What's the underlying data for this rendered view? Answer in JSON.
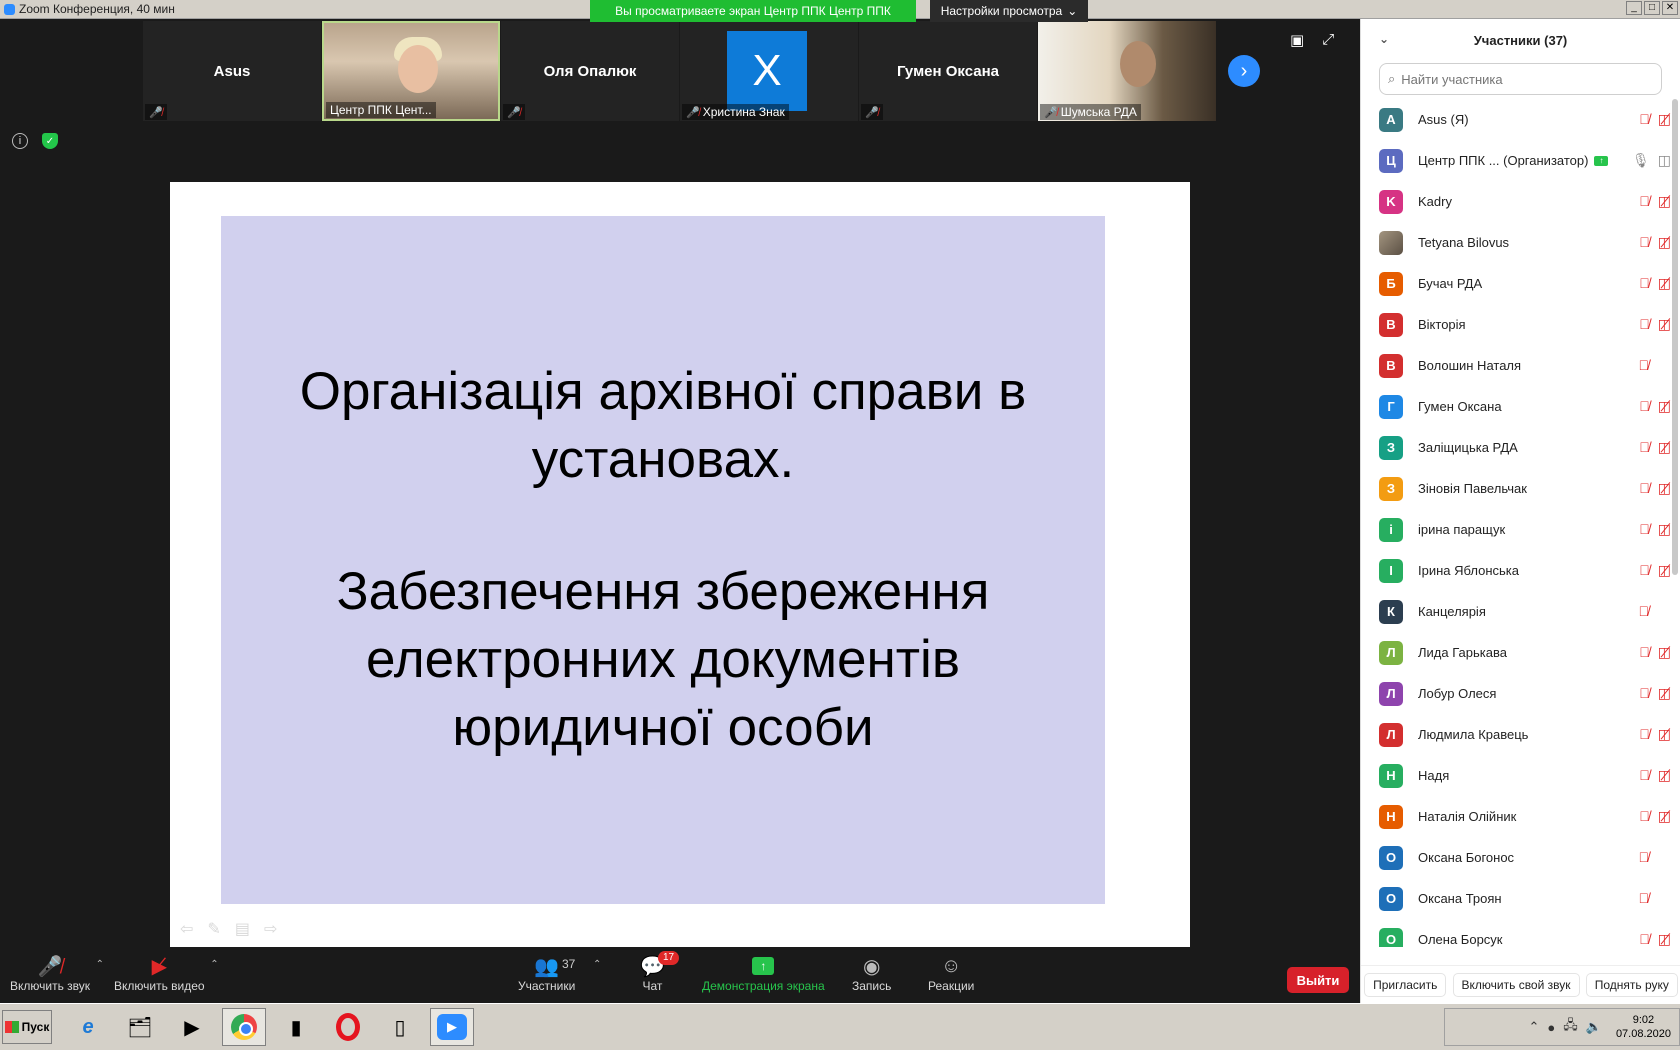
{
  "window": {
    "title": "Zoom Конференция, 40 мин",
    "share_banner": "Вы просматриваете экран Центр ППК Центр ППК",
    "view_settings": "Настройки просмотра"
  },
  "video_strip": [
    {
      "name": "Asus",
      "label": "",
      "kind": "name"
    },
    {
      "name": "",
      "label": "Центр ППК Цент...",
      "kind": "photo-a"
    },
    {
      "name": "Оля Опалюк",
      "label": "",
      "kind": "name"
    },
    {
      "name": "",
      "label": "Христина Знак",
      "kind": "avatar",
      "avatar_letter": "Х"
    },
    {
      "name": "Гумен Оксана",
      "label": "",
      "kind": "name"
    },
    {
      "name": "",
      "label": "Шумська РДА",
      "kind": "photo-b"
    }
  ],
  "slide": {
    "line1": "Організація архівної справи в установах.",
    "line2": "Забезпечення збереження електронних документів юридичної особи",
    "background": "#d1d0ee"
  },
  "toolbar": {
    "audio": "Включить звук",
    "video": "Включить видео",
    "participants": "Участники",
    "participants_count": "37",
    "chat": "Чат",
    "chat_badge": "17",
    "share": "Демонстрация экрана",
    "record": "Запись",
    "reactions": "Реакции",
    "leave": "Выйти"
  },
  "panel": {
    "title": "Участники (37)",
    "search_placeholder": "Найти участника",
    "participants": [
      {
        "letter": "A",
        "name": "Asus (Я)",
        "color": "#3a7a83",
        "mic": "muted",
        "cam": "off"
      },
      {
        "letter": "Ц",
        "name": "Центр ППК ... (Организатор)",
        "color": "#5c6bc0",
        "mic": "on",
        "cam": "on",
        "sharing": true
      },
      {
        "letter": "K",
        "name": "Kadry",
        "color": "#d63384",
        "mic": "muted",
        "cam": "off"
      },
      {
        "letter": "",
        "name": "Tetyana Bilovus",
        "color": "#8a8070",
        "mic": "muted",
        "cam": "off"
      },
      {
        "letter": "Б",
        "name": "Бучач РДА",
        "color": "#e65c00",
        "mic": "muted",
        "cam": "off"
      },
      {
        "letter": "В",
        "name": "Вікторія",
        "color": "#d32f2f",
        "mic": "muted",
        "cam": "off"
      },
      {
        "letter": "В",
        "name": "Волошин Наталя",
        "color": "#d32f2f",
        "mic": "muted",
        "cam": "none"
      },
      {
        "letter": "Г",
        "name": "Гумен Оксана",
        "color": "#1e88e5",
        "mic": "muted",
        "cam": "off"
      },
      {
        "letter": "З",
        "name": "Заліщицька РДА",
        "color": "#16a085",
        "mic": "muted",
        "cam": "off"
      },
      {
        "letter": "З",
        "name": "Зіновія Павельчак",
        "color": "#f39c12",
        "mic": "muted",
        "cam": "off"
      },
      {
        "letter": "і",
        "name": "ірина паращук",
        "color": "#27ae60",
        "mic": "muted",
        "cam": "off"
      },
      {
        "letter": "І",
        "name": "Ірина Яблонська",
        "color": "#27ae60",
        "mic": "muted",
        "cam": "off"
      },
      {
        "letter": "К",
        "name": "Канцелярія",
        "color": "#2c3e50",
        "mic": "muted",
        "cam": "none"
      },
      {
        "letter": "Л",
        "name": "Лида Гарькава",
        "color": "#7cb342",
        "mic": "muted",
        "cam": "off"
      },
      {
        "letter": "Л",
        "name": "Лобур Олеся",
        "color": "#8e44ad",
        "mic": "muted",
        "cam": "off"
      },
      {
        "letter": "Л",
        "name": "Людмила Кравець",
        "color": "#d32f2f",
        "mic": "muted",
        "cam": "off"
      },
      {
        "letter": "Н",
        "name": "Надя",
        "color": "#27ae60",
        "mic": "muted",
        "cam": "off"
      },
      {
        "letter": "Н",
        "name": "Наталія Олійник",
        "color": "#e65c00",
        "mic": "muted",
        "cam": "off"
      },
      {
        "letter": "О",
        "name": "Оксана Богонос",
        "color": "#1e6fb8",
        "mic": "muted",
        "cam": "none"
      },
      {
        "letter": "О",
        "name": "Оксана Троян",
        "color": "#1e6fb8",
        "mic": "muted",
        "cam": "none"
      },
      {
        "letter": "О",
        "name": "Олена Борсук",
        "color": "#27ae60",
        "mic": "muted",
        "cam": "off"
      }
    ],
    "footer": {
      "invite": "Пригласить",
      "unmute_self": "Включить свой звук",
      "raise_hand": "Поднять руку"
    }
  },
  "taskbar": {
    "start": "Пуск",
    "time": "9:02",
    "date": "07.08.2020"
  }
}
